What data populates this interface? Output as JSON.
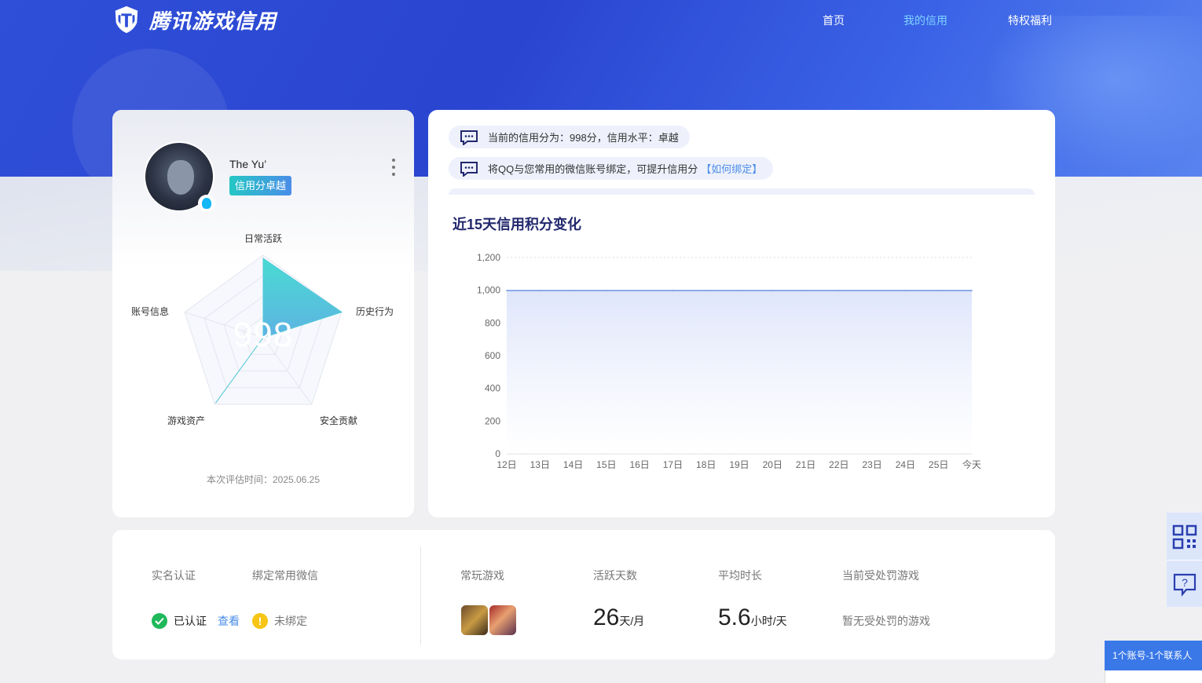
{
  "brand": {
    "name": "腾讯游戏信用",
    "logo_icon": "shield-logo-icon"
  },
  "nav": [
    {
      "label": "首页",
      "active": false
    },
    {
      "label": "我的信用",
      "active": true
    },
    {
      "label": "特权福利",
      "active": false
    }
  ],
  "profile": {
    "username": "The Yu’",
    "level_tag": "信用分卓越",
    "score": "998",
    "radar_labels": {
      "daily": "日常活跃",
      "history": "历史行为",
      "security": "安全贡献",
      "assets": "游戏资产",
      "account": "账号信息"
    },
    "radar_values": {
      "daily": 0.96,
      "history": 1.0,
      "security": 0.0,
      "assets": 0.98,
      "account": 0.0
    },
    "eval_time": "本次评估时间：2025.06.25"
  },
  "notices": [
    {
      "text": "当前的信用分为：998分，信用水平：卓越",
      "link": ""
    },
    {
      "text": "将QQ与您常用的微信账号绑定，可提升信用分",
      "link": "【如何绑定】"
    }
  ],
  "chart_title": "近15天信用积分变化",
  "chart_data": {
    "type": "area",
    "title": "近15天信用积分变化",
    "categories": [
      "12日",
      "13日",
      "14日",
      "15日",
      "16日",
      "17日",
      "18日",
      "19日",
      "20日",
      "21日",
      "22日",
      "23日",
      "24日",
      "25日",
      "今天"
    ],
    "values": [
      998,
      998,
      998,
      998,
      998,
      998,
      998,
      998,
      998,
      998,
      998,
      998,
      998,
      998,
      998
    ],
    "yticks": [
      "0",
      "200",
      "400",
      "600",
      "800",
      "1,000",
      "1,200"
    ],
    "ylim": [
      0,
      1200
    ],
    "grid": "top-dotted",
    "line_color": "#6a94e0",
    "fill_color": "#dfe6fb"
  },
  "stats": {
    "real_name_label": "实名认证",
    "real_name_status": "已认证",
    "view_link": "查看",
    "wechat_label": "绑定常用微信",
    "wechat_status": "未绑定",
    "games_label": "常玩游戏",
    "active_days_label": "活跃天数",
    "active_days_value": "26",
    "active_days_unit": "天/月",
    "avg_time_label": "平均时长",
    "avg_time_value": "5.6",
    "avg_time_unit": "小时/天",
    "penalty_label": "当前受处罚游戏",
    "penalty_value": "暂无受处罚的游戏"
  },
  "side": {
    "qr_icon": "qr-code-icon",
    "help_icon": "help-chat-icon"
  },
  "contact_tab": "1个账号-1个联系人",
  "colors": {
    "accent": "#2f4fd8",
    "link": "#4a8de8",
    "success": "#1fb85a",
    "warning": "#f6c515",
    "chart_title": "#22286e"
  }
}
